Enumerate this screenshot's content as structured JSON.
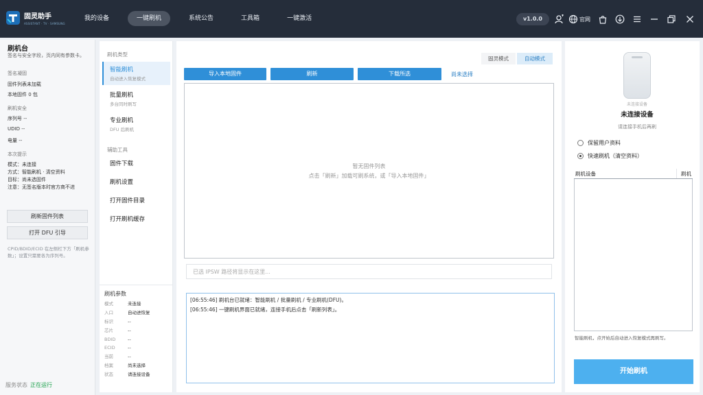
{
  "app": {
    "name": "固灵助手",
    "subtitle": "ASSISTANT · TV · SAMSUNG",
    "version": "v1.0.0",
    "official_label": "官网"
  },
  "nav": {
    "items": [
      "我的设备",
      "一键刷机",
      "系统公告",
      "工具箱",
      "一键激活"
    ],
    "active": "一键刷机"
  },
  "left": {
    "title": "刷机台",
    "desc": "签名与安全字段，页内同有参数卡。",
    "sign_section": "签名凝固",
    "fw_list_status": "固件列表未加载",
    "local_fw_count": "本地固件 0 包",
    "security_section": "刷机安全",
    "serial": "序列号 --",
    "udid": "UDID --",
    "battery": "电量 --",
    "hint_section": "本次提示",
    "mode_line": "模式：未连接",
    "method_line": "方式：智能刷机 · 清空资料",
    "target_line": "目标：尚未选固件",
    "note_line": "注意：无签名版本时官方商不进",
    "refresh_button": "刷新固件列表",
    "dfu_button": "打开 DFU 引导",
    "ecid_note": "CPID/BDID/ECID 在左侧栏下方「刷机参数」；设置只需要各为序列号。",
    "status_label": "服务状态",
    "status_value": "正在运行"
  },
  "menu": {
    "type_section": "刷机类型",
    "items": [
      {
        "title": "智能刷机",
        "sub": "自动进入恢复模式"
      },
      {
        "title": "批量刷机",
        "sub": "多台同时刷写"
      },
      {
        "title": "专业刷机",
        "sub": "DFU 后刷机"
      }
    ],
    "tools_section": "辅助工具",
    "tools": [
      "固件下载",
      "刷机设置",
      "打开固件目录",
      "打开刷机缓存"
    ],
    "params_title": "刷机参数",
    "params": [
      {
        "k": "模式",
        "v": "未连接"
      },
      {
        "k": "入口",
        "v": "自动进恢复"
      },
      {
        "k": "标识",
        "v": "--"
      },
      {
        "k": "芯片",
        "v": "--"
      },
      {
        "k": "BDID",
        "v": "--"
      },
      {
        "k": "ECID",
        "v": "--"
      },
      {
        "k": "当前",
        "v": "--"
      },
      {
        "k": "档案",
        "v": "尚未选择"
      },
      {
        "k": "状态",
        "v": "请连接设备"
      }
    ]
  },
  "center": {
    "mode_off": "固灵模式",
    "mode_on": "自动模式",
    "btn_import": "导入本地固件",
    "btn_refresh": "刷新",
    "btn_download": "下载所选",
    "link_unselected": "尚未选择",
    "empty_title": "暂无固件列表",
    "empty_hint": "点击「刷新」加载可刷系统，或「导入本地固件」",
    "path_placeholder": "已选 IPSW 路径将显示在这里...",
    "logs": [
      "[06:55:46] 刷机台已就绪：智能刷机 / 批量刷机 / 专业刷机(DFU)。",
      "[06:55:46] 一键刷机界面已就绪，连接手机后点击「刷新列表」。"
    ]
  },
  "right": {
    "phone_caption": "未连接设备",
    "device_title": "未连接设备",
    "device_sub": "请连接手机后再刷",
    "radio_keep": "保留用户资料",
    "radio_fast": "快速刷机（清空资料）",
    "radio_selected": "fast",
    "table_col1": "刷机设备",
    "table_col2": "刷机",
    "note": "智能刷机，点开始后自动进入恢复模式再刷写。",
    "start_button": "开始刷机"
  }
}
